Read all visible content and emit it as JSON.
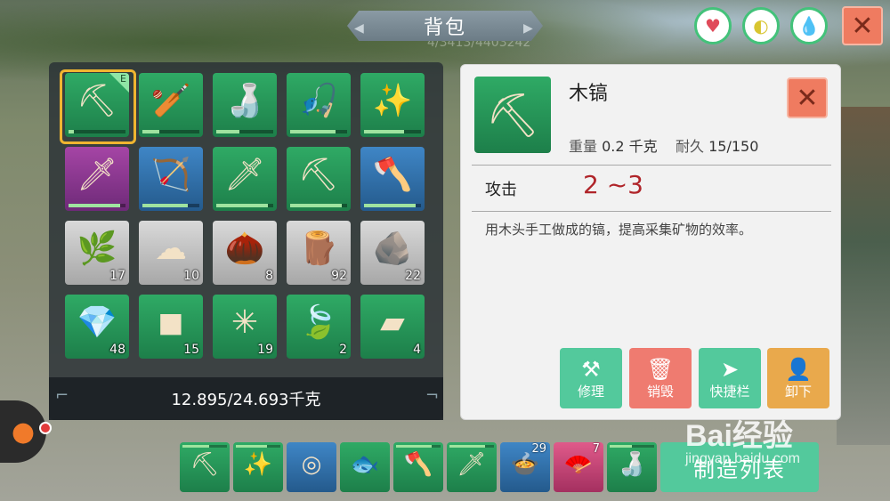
{
  "title": "背包",
  "ghost_text": "4/3413/4403242",
  "status_icons": [
    "heart-icon",
    "stomach-icon",
    "water-drop-icon"
  ],
  "inventory": {
    "weight_text": "12.895/24.693千克",
    "slots": [
      {
        "name": "wood-pickaxe",
        "icon": "⛏",
        "color": "green",
        "durability": 0.1,
        "equipped": true,
        "equip_tag": "E"
      },
      {
        "name": "wood-club",
        "icon": "🏏",
        "color": "green",
        "durability": 0.3
      },
      {
        "name": "water-gourd",
        "icon": "🍶",
        "color": "green",
        "durability": 0.4
      },
      {
        "name": "fishing-rod",
        "icon": "🎣",
        "color": "green",
        "durability": 0.8
      },
      {
        "name": "magic-staff",
        "icon": "✨",
        "color": "green",
        "durability": 0.7
      },
      {
        "name": "stone-sword",
        "icon": "🗡",
        "color": "purple",
        "durability": 0.9
      },
      {
        "name": "bow",
        "icon": "🏹",
        "color": "blue",
        "durability": 0.8
      },
      {
        "name": "iron-sword",
        "icon": "🗡",
        "color": "green",
        "durability": 0.9
      },
      {
        "name": "iron-pickaxe",
        "icon": "⛏",
        "color": "green",
        "durability": 0.9
      },
      {
        "name": "battle-axe",
        "icon": "🪓",
        "color": "blue",
        "durability": 0.9
      },
      {
        "name": "fiber",
        "icon": "🌿",
        "color": "grey",
        "count": "17"
      },
      {
        "name": "cotton",
        "icon": "☁",
        "color": "grey",
        "count": "10"
      },
      {
        "name": "seed-pod",
        "icon": "🌰",
        "color": "grey",
        "count": "8"
      },
      {
        "name": "wood-log",
        "icon": "🪵",
        "color": "grey",
        "count": "92"
      },
      {
        "name": "stone-ore",
        "icon": "🪨",
        "color": "grey",
        "count": "22"
      },
      {
        "name": "crystal",
        "icon": "💎",
        "color": "green",
        "count": "48"
      },
      {
        "name": "coal",
        "icon": "◼",
        "color": "green",
        "count": "15"
      },
      {
        "name": "energy-orb",
        "icon": "✳",
        "color": "green",
        "count": "19"
      },
      {
        "name": "leaf",
        "icon": "🍃",
        "color": "green",
        "count": "2"
      },
      {
        "name": "iron-ingot",
        "icon": "▰",
        "color": "green",
        "count": "4"
      }
    ]
  },
  "detail": {
    "name": "木镐",
    "weight_label": "重量",
    "weight_value": "0.2 千克",
    "durability_label": "耐久",
    "durability_value": "15/150",
    "attack_label": "攻击",
    "attack_value": "2 ~3",
    "description": "用木头手工做成的镐，提高采集矿物的效率。",
    "actions": {
      "repair": "修理",
      "destroy": "销毁",
      "quickbar": "快捷栏",
      "unequip": "卸下"
    }
  },
  "hotbar": [
    {
      "name": "iron-pickaxe",
      "icon": "⛏",
      "color": "green",
      "durability": 0.6
    },
    {
      "name": "magic-staff",
      "icon": "✨",
      "color": "green",
      "durability": 0.7
    },
    {
      "name": "stone-disc",
      "icon": "◎",
      "color": "blue"
    },
    {
      "name": "fish",
      "icon": "🐟",
      "color": "green"
    },
    {
      "name": "battle-axe",
      "icon": "🪓",
      "color": "green",
      "durability": 0.8
    },
    {
      "name": "iron-sword",
      "icon": "🗡",
      "color": "green",
      "durability": 0.8
    },
    {
      "name": "bread-bowl",
      "icon": "🍲",
      "color": "blue",
      "count": "29"
    },
    {
      "name": "fan",
      "icon": "🪭",
      "color": "pink",
      "count": "7"
    },
    {
      "name": "water-gourd",
      "icon": "🍶",
      "color": "green",
      "durability": 0.5
    }
  ],
  "craft_label": "制造列表",
  "watermark": {
    "big": "Bai经验",
    "small": "jingyan.baidu.com"
  }
}
